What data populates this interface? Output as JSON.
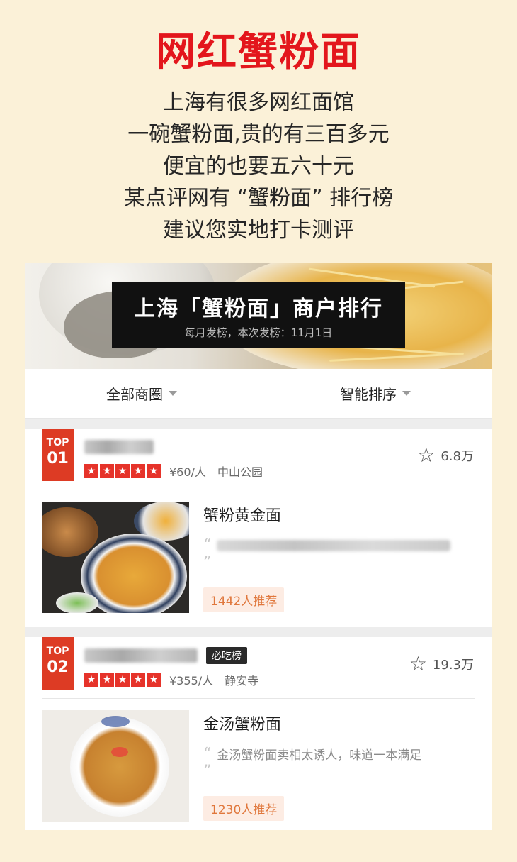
{
  "header": {
    "title": "网红蟹粉面",
    "intro_lines": [
      "上海有很多网红面馆",
      "一碗蟹粉面,贵的有三百多元",
      "便宜的也要五六十元",
      "某点评网有 “蟹粉面” 排行榜",
      "建议您实地打卡测评"
    ]
  },
  "banner": {
    "title": "上海「蟹粉面」商户排行",
    "subtitle": "每月发榜，本次发榜：11月1日"
  },
  "filters": {
    "area_label": "全部商圈",
    "sort_label": "智能排序",
    "caret_icon": "chevron-down-icon"
  },
  "colors": {
    "title_red": "#e3161c",
    "badge_red": "#dd3b24",
    "recommend_text": "#e0773c",
    "recommend_bg": "#fdece3"
  },
  "entries": [
    {
      "rank_top": "TOP",
      "rank_num": "01",
      "tag": "",
      "rating": 5,
      "price": "¥60/人",
      "area": "中山公园",
      "favorites": "6.8万",
      "dish": "蟹粉黄金面",
      "review": "",
      "recommend": "1442人推荐"
    },
    {
      "rank_top": "TOP",
      "rank_num": "02",
      "tag": "必吃榜",
      "rating": 5,
      "price": "¥355/人",
      "area": "静安寺",
      "favorites": "19.3万",
      "dish": "金汤蟹粉面",
      "review": "金汤蟹粉面卖相太诱人，味道一本满足",
      "recommend": "1230人推荐"
    }
  ]
}
